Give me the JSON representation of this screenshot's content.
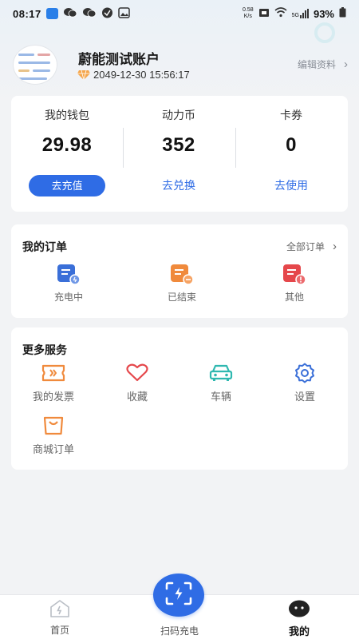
{
  "status_bar": {
    "time": "08:17",
    "net_speed_value": "0.58",
    "net_speed_unit": "K/s",
    "signal_label": "5G",
    "battery": "93%"
  },
  "profile": {
    "username": "蔚能测试账户",
    "vip_expiry": "2049-12-30 15:56:17",
    "edit_label": "编辑资料",
    "chevron": "›"
  },
  "wallet": {
    "items": [
      {
        "label": "我的钱包",
        "value": "29.98",
        "action": "去充值"
      },
      {
        "label": "动力币",
        "value": "352",
        "action": "去兑换"
      },
      {
        "label": "卡券",
        "value": "0",
        "action": "去使用"
      }
    ]
  },
  "orders": {
    "title": "我的订单",
    "more": "全部订单",
    "chevron": "›",
    "items": [
      {
        "label": "充电中",
        "icon": "charging-order-icon",
        "color": "#3a6fd8"
      },
      {
        "label": "已结束",
        "icon": "finished-order-icon",
        "color": "#f08a3c"
      },
      {
        "label": "其他",
        "icon": "other-order-icon",
        "color": "#e5474b"
      }
    ]
  },
  "services": {
    "title": "更多服务",
    "items": [
      {
        "label": "我的发票",
        "icon": "invoice-icon",
        "color": "#f08a3c"
      },
      {
        "label": "收藏",
        "icon": "heart-icon",
        "color": "#e5474b"
      },
      {
        "label": "车辆",
        "icon": "car-icon",
        "color": "#2fb8b0"
      },
      {
        "label": "设置",
        "icon": "gear-icon",
        "color": "#3a6fd8"
      },
      {
        "label": "商城订单",
        "icon": "shopping-bag-icon",
        "color": "#f08a3c"
      }
    ]
  },
  "tabbar": {
    "home": "首页",
    "scan": "扫码充电",
    "me": "我的"
  },
  "colors": {
    "accent": "#2f6ce5",
    "background": "#f2f3f5"
  }
}
